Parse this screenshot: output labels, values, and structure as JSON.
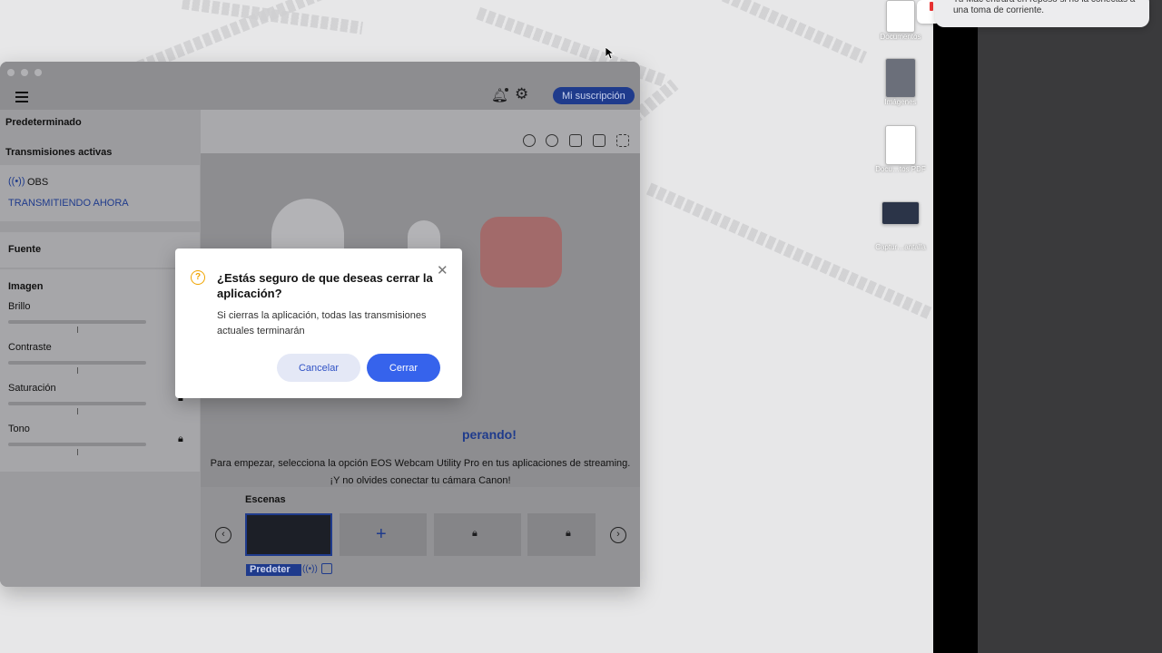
{
  "desktop": {
    "notification_text": "Tu Mac entrará en reposo si no la conectas a una toma de corriente.",
    "icons": [
      {
        "label": "Documentos"
      },
      {
        "label": "Imágenes"
      },
      {
        "label": "Docu…tos PDF"
      },
      {
        "label": "Captur…antalla"
      }
    ]
  },
  "toolbar": {
    "subscription_label": "Mi suscripción"
  },
  "sidebar": {
    "preset": "Predeterminado",
    "active_streams_title": "Transmisiones activas",
    "stream_name": "OBS",
    "stream_status": "TRANSMITIENDO AHORA",
    "source_title": "Fuente",
    "image_title": "Imagen",
    "adjustments": [
      {
        "label": "Brillo",
        "value": 0.5
      },
      {
        "label": "Contraste",
        "value": 0.5
      },
      {
        "label": "Saturación",
        "value": 0.5
      },
      {
        "label": "Tono",
        "value": 0.5
      }
    ]
  },
  "main": {
    "waiting_fragment": "perando!",
    "instruction_line1": "Para empezar, selecciona la opción EOS Webcam Utility Pro en tus aplicaciones de streaming.",
    "instruction_line2": "¡Y no olvides conectar tu cámara Canon!"
  },
  "scenes": {
    "title": "Escenas",
    "active_scene_label": "Predeter"
  },
  "dialog": {
    "title": "¿Estás seguro de que deseas cerrar la aplicación?",
    "body": "Si cierras la aplicación, todas las transmisiones actuales terminarán",
    "cancel_label": "Cancelar",
    "confirm_label": "Cerrar"
  },
  "colors": {
    "accent": "#3663ec",
    "subscription_button": "#1f3b8c",
    "warning": "#f0a400"
  }
}
